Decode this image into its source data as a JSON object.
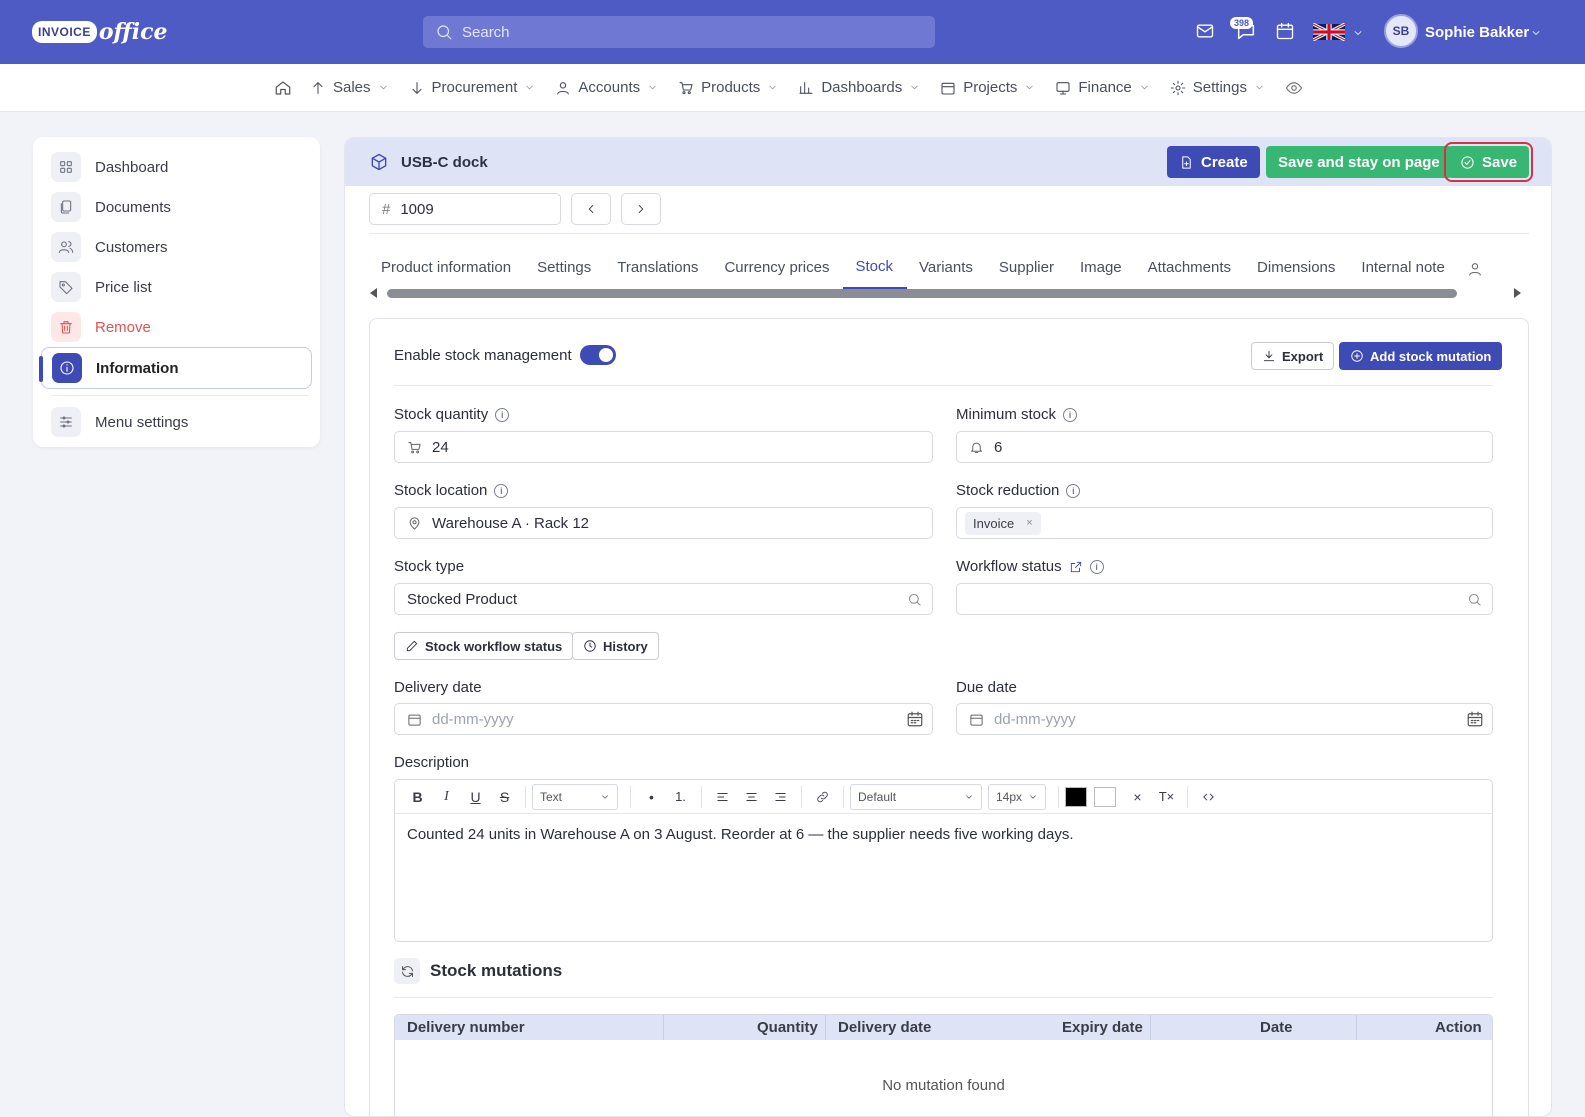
{
  "brand": {
    "box": "INVOICE",
    "script": "office"
  },
  "search": {
    "placeholder": "Search"
  },
  "header": {
    "notifications_count": "398",
    "user_initials": "SB",
    "user_name": "Sophie Bakker"
  },
  "nav": [
    "Sales",
    "Procurement",
    "Accounts",
    "Products",
    "Dashboards",
    "Projects",
    "Finance",
    "Settings"
  ],
  "sidebar": {
    "items": [
      "Dashboard",
      "Documents",
      "Customers",
      "Price list",
      "Remove",
      "Information"
    ],
    "menu_settings": "Menu settings"
  },
  "product": {
    "title": "USB-C dock",
    "create": "Create",
    "save_stay": "Save and stay on page",
    "save": "Save",
    "number": "1009"
  },
  "tabs": [
    "Product information",
    "Settings",
    "Translations",
    "Currency prices",
    "Stock",
    "Variants",
    "Supplier",
    "Image",
    "Attachments",
    "Dimensions",
    "Internal note"
  ],
  "stock": {
    "enable_label": "Enable stock management",
    "export": "Export",
    "add_mutation": "Add stock mutation",
    "quantity_label": "Stock quantity",
    "quantity_value": "24",
    "minimum_label": "Minimum stock",
    "minimum_value": "6",
    "location_label": "Stock location",
    "location_value": "Warehouse A · Rack 12",
    "reduction_label": "Stock reduction",
    "reduction_chip": "Invoice",
    "type_label": "Stock type",
    "type_value": "Stocked Product",
    "workflow_label": "Workflow status",
    "workflow_btn": "Stock workflow status",
    "history_btn": "History",
    "delivery_label": "Delivery date",
    "due_label": "Due date",
    "date_placeholder": "dd-mm-yyyy",
    "description_label": "Description",
    "editor": {
      "format": "Text",
      "font": "Default",
      "size": "14px"
    },
    "description_text": "Counted 24 units in Warehouse A on 3 August. Reorder at 6 — the supplier needs five working days."
  },
  "mutations": {
    "title": "Stock mutations",
    "columns": [
      "Delivery number",
      "Quantity",
      "Delivery date",
      "Expiry date",
      "Date",
      "Action"
    ],
    "empty": "No mutation found"
  }
}
